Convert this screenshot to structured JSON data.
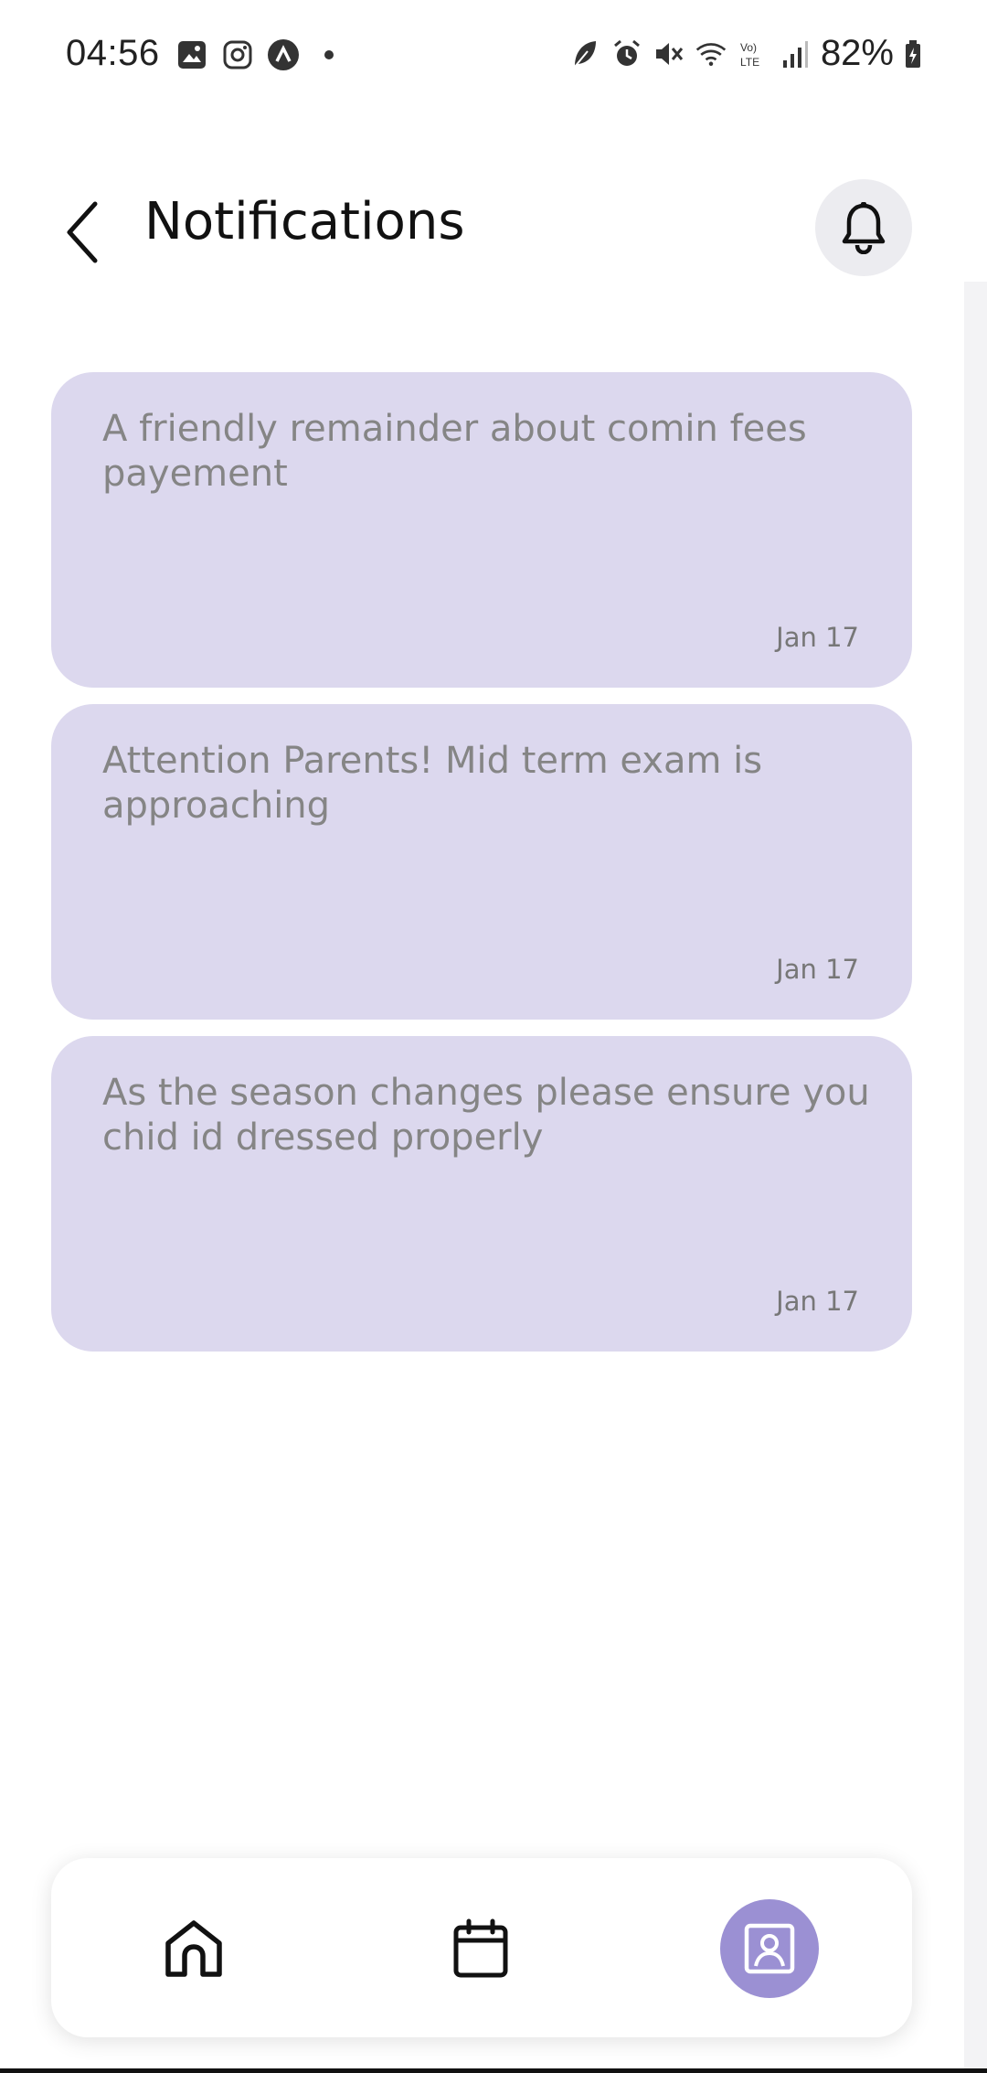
{
  "status_bar": {
    "time": "04:56",
    "battery_percent": "82%",
    "left_icons": [
      "gallery-icon",
      "instagram-icon",
      "app-icon",
      "dot-icon"
    ],
    "right_icons": [
      "leaf-icon",
      "alarm-icon",
      "mute-icon",
      "wifi-icon",
      "volte-icon",
      "signal-icon",
      "battery-icon"
    ]
  },
  "header": {
    "title": "Notifications"
  },
  "notifications": [
    {
      "message": "A friendly remainder about comin fees payement",
      "date": "Jan 17"
    },
    {
      "message": "Attention Parents! Mid term exam is approaching",
      "date": "Jan 17"
    },
    {
      "message": "As the season changes please ensure you chid id dressed properly",
      "date": "Jan 17"
    }
  ],
  "bottom_nav": {
    "items": [
      {
        "icon": "home-icon",
        "active": false
      },
      {
        "icon": "calendar-icon",
        "active": false
      },
      {
        "icon": "profile-icon",
        "active": true
      }
    ]
  },
  "colors": {
    "card_background": "#dcd8ee",
    "accent": "#9b90d3",
    "bell_background": "#ececf0",
    "notification_text": "#858585"
  }
}
